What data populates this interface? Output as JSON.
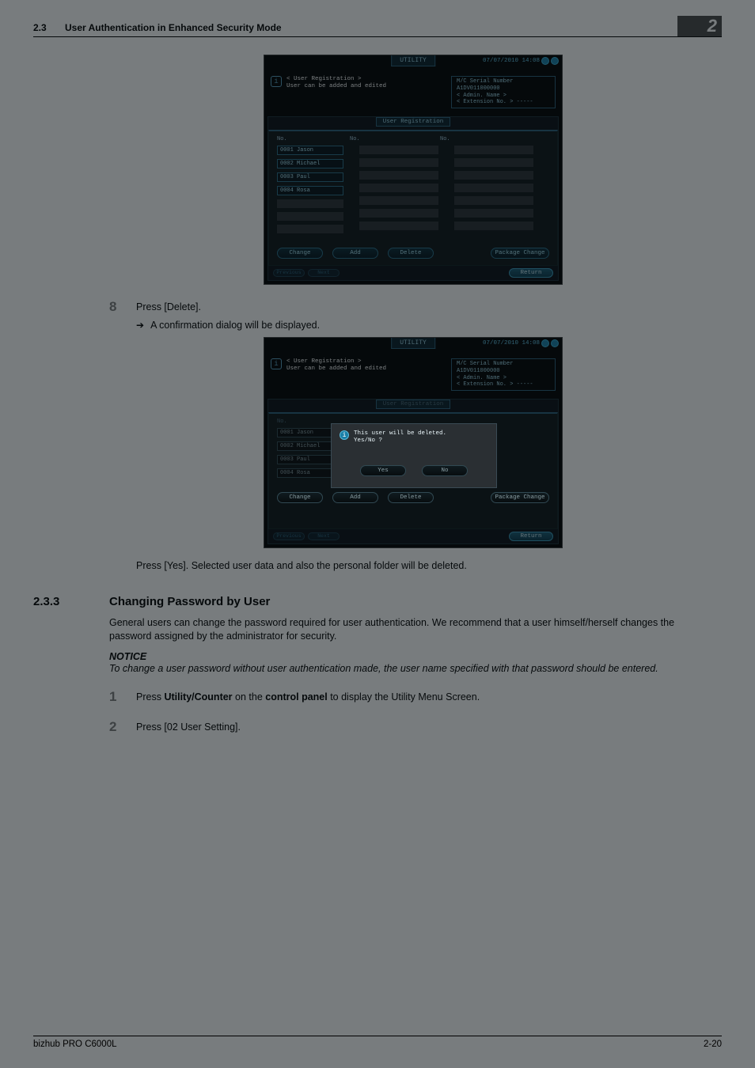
{
  "header": {
    "section_no": "2.3",
    "title": "User Authentication in Enhanced Security Mode",
    "chapter": "2"
  },
  "step8": {
    "num": "8",
    "text": "Press [Delete].",
    "arrow": "A confirmation dialog will be displayed."
  },
  "afternote": "Press [Yes]. Selected user data and also the personal folder will be deleted.",
  "section": {
    "num": "2.3.3",
    "title": "Changing Password by User",
    "body": "General users can change the password required for user authentication. We recommend that a user him­self/herself changes the password assigned by the administrator for security.",
    "notice_h": "NOTICE",
    "notice_b": "To change a user password without user authentication made, the user name specified with that password should be entered."
  },
  "steps": {
    "s1": {
      "num": "1",
      "prefix": "Press ",
      "b1": "Utility/Counter",
      "mid": " on the ",
      "b2": "control panel",
      "suffix": " to display the Utility Menu Screen."
    },
    "s2": {
      "num": "2",
      "text": "Press [02 User Setting]."
    }
  },
  "footer": {
    "left": "bizhub PRO C6000L",
    "right": "2-20"
  },
  "shot1": {
    "tab": "UTILITY",
    "date": "07/07/2010  14:08",
    "info_l1": "< User Registration >",
    "info_l2": "User can be added and edited",
    "mc_l1": "M/C Serial Number  A1DV011000000",
    "mc_l2": "< Admin. Name >",
    "mc_l3": "< Extension No. >  -----",
    "reg_title": "User Registration",
    "col_no": "No.",
    "users": [
      "0001 Jason",
      "0002 Michael",
      "0003 Paul",
      "0004 Rosa"
    ],
    "btn_change": "Change",
    "btn_add": "Add",
    "btn_delete": "Delete",
    "btn_pkg": "Package Change",
    "prev": "Previous",
    "next": "Next",
    "return": "Return"
  },
  "shot2": {
    "tab": "UTILITY",
    "date": "07/07/2010  14:08",
    "info_l1": "< User Registration >",
    "info_l2": "User can be added and edited",
    "mc_l1": "M/C Serial Number  A1DV011000000",
    "mc_l2": "< Admin. Name >",
    "mc_l3": "< Extension No. >  -----",
    "reg_title": "User Registration",
    "col_no": "No.",
    "users": [
      "0001 Jason",
      "0002 Michael",
      "0003 Paul",
      "0004 Rosa"
    ],
    "dlg_msg": "This user will be deleted.\nYes/No ?",
    "dlg_yes": "Yes",
    "dlg_no": "No",
    "btn_change": "Change",
    "btn_add": "Add",
    "btn_delete": "Delete",
    "btn_pkg": "Package Change",
    "prev": "Previous",
    "next": "Next",
    "return": "Return"
  }
}
